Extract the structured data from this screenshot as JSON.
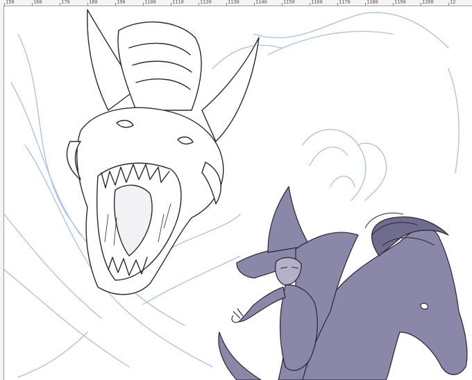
{
  "ruler": {
    "tick_labels": [
      "150",
      "160",
      "170",
      "180",
      "190",
      "1100",
      "1110",
      "1120",
      "1130",
      "1140",
      "1150",
      "1160",
      "1170",
      "1180",
      "1190",
      "1200",
      "12"
    ]
  },
  "colors": {
    "ink": "#262630",
    "sketch": "#a9bfe6",
    "fill": "#8a87a8",
    "ruler_bg": "#f4f4f4"
  },
  "canvas": {
    "layers": [
      "dragon-head-lineart",
      "witch-rider-flat",
      "horse-flat",
      "blue-sketch"
    ]
  }
}
